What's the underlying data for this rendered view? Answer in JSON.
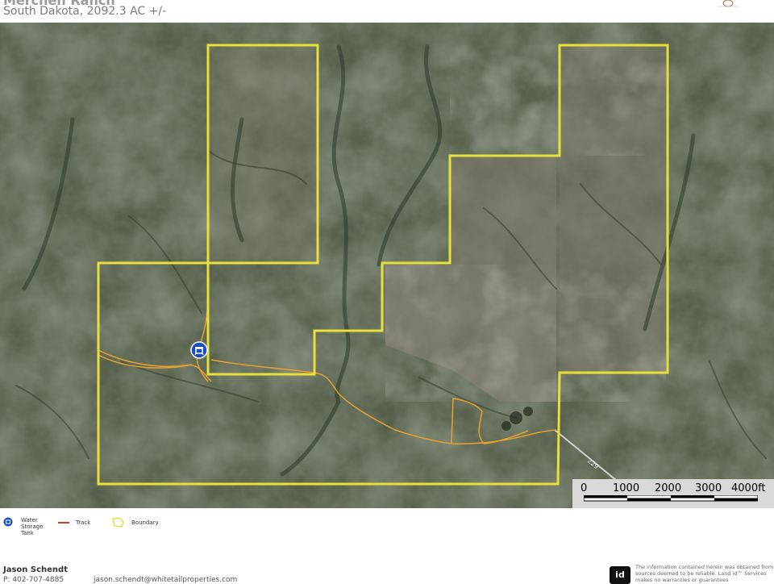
{
  "header": {
    "title": "Merchen Ranch",
    "subtitle": "South Dakota, 2092.3 AC +/-"
  },
  "scale": {
    "labels": [
      "0",
      "1000",
      "2000",
      "3000",
      "4000ft"
    ]
  },
  "road_label": "229",
  "legend": {
    "items": [
      {
        "label": "Water Storage Tank",
        "icon": "water-tank-icon"
      },
      {
        "label": "Track",
        "color": "#e03a1e"
      },
      {
        "label": "Boundary",
        "color": "#e8e03a"
      }
    ]
  },
  "footer": {
    "agent_name": "Jason Schendt",
    "agent_phone": "P: 402-707-4885",
    "agent_email": "jason.schendt@whitetailproperties.com",
    "logo_text": "id",
    "disclaimer": "The information contained herein was obtained from sources deemed to be reliable. Land id™ Services makes no warranties or guarantees"
  },
  "colors": {
    "boundary": "#e8e03a",
    "track": "#e8a030",
    "imagery_base": "#56604a"
  }
}
